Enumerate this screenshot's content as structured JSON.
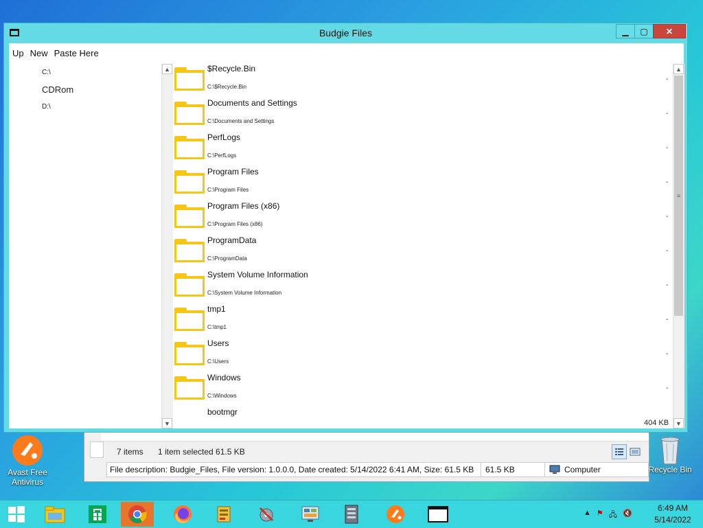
{
  "desktop": {
    "icons": [
      {
        "label": "Avast Free\nAntivirus",
        "name": "avast"
      },
      {
        "label": "Recycle Bin",
        "name": "recycle-bin"
      }
    ]
  },
  "window": {
    "title": "Budgie Files",
    "controls": {
      "min": "▁",
      "max": "▢",
      "close": "✕"
    },
    "menu": {
      "up": "Up",
      "new": "New",
      "paste": "Paste Here"
    },
    "tree": [
      {
        "label": "C:\\",
        "big": false
      },
      {
        "label": "CDRom",
        "big": true
      },
      {
        "label": "D:\\",
        "big": false
      }
    ],
    "files": [
      {
        "name": "$Recycle.Bin",
        "path": "C:\\$Recycle.Bin",
        "size": "-"
      },
      {
        "name": "Documents and Settings",
        "path": "C:\\Documents and Settings",
        "size": "-"
      },
      {
        "name": "PerfLogs",
        "path": "C:\\PerfLogs",
        "size": "-"
      },
      {
        "name": "Program Files",
        "path": "C:\\Program Files",
        "size": "-"
      },
      {
        "name": "Program Files (x86)",
        "path": "C:\\Program Files (x86)",
        "size": "-"
      },
      {
        "name": "ProgramData",
        "path": "C:\\ProgramData",
        "size": "-"
      },
      {
        "name": "System Volume Information",
        "path": "C:\\System Volume Information",
        "size": "-"
      },
      {
        "name": "tmp1",
        "path": "C:\\tmp1",
        "size": "-"
      },
      {
        "name": "Users",
        "path": "C:\\Users",
        "size": "-"
      },
      {
        "name": "Windows",
        "path": "C:\\Windows",
        "size": "-"
      },
      {
        "name": "bootmgr",
        "path": "",
        "size": "404 KB"
      }
    ]
  },
  "background_window": {
    "item_count": "7 items",
    "selection": "1 item selected  61.5 KB",
    "status_description": "File description: Budgie_Files, File version: 1.0.0.0, Date created: 5/14/2022 6:41 AM, Size: 61.5 KB",
    "status_size": "61.5 KB",
    "status_location": "Computer"
  },
  "taskbar": {
    "items": [
      "start",
      "file-explorer",
      "store",
      "chrome",
      "firefox",
      "app-gold",
      "tools",
      "control-panel",
      "server-manager",
      "avast",
      "budgie-files"
    ],
    "active": "chrome",
    "clock_time": "6:49 AM",
    "clock_date": "5/14/2022"
  },
  "colors": {
    "window_frame": "#64dbe4",
    "taskbar": "#3ad6df",
    "folder": "#f5c518",
    "close_button": "#c8463c",
    "active_task": "#e8752c"
  }
}
